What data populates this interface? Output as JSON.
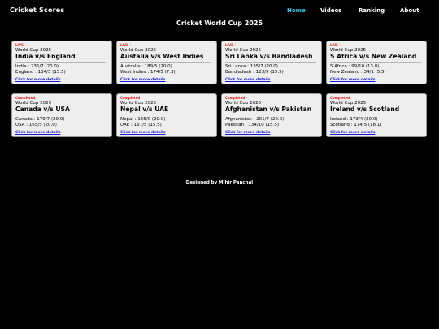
{
  "brand": "Cricket Scores",
  "nav": [
    {
      "label": "Home",
      "active": true
    },
    {
      "label": "Videos",
      "active": false
    },
    {
      "label": "Ranking",
      "active": false
    },
    {
      "label": "About",
      "active": false
    }
  ],
  "page_title": "Cricket World Cup 2025",
  "matches": [
    {
      "status": "LIVE •",
      "tournament": "World Cup 2025",
      "title": "India v/s England",
      "score1": "India : 235/7 (20.0)",
      "score2": "England : 134/5 (15.5)",
      "link": "Click for more details"
    },
    {
      "status": "LIVE •",
      "tournament": "World Cup 2025",
      "title": "Austalia v/s West Indies",
      "score1": "Australia : 189/5 (20.0)",
      "score2": "West Indies : 174/5 (7.3)",
      "link": "Click for more details"
    },
    {
      "status": "LIVE •",
      "tournament": "World Cup 2025",
      "title": "Sri Lanka v/s Bandladesh",
      "score1": "Sri Lanka : 135/7 (20.0)",
      "score2": "Bandladesh : 123/9 (15.5)",
      "link": "Click for more details"
    },
    {
      "status": "LIVE •",
      "tournament": "World Cup 2025",
      "title": "S Africa v/s New Zealand",
      "score1": "S Africa : 99/10 (13.0)",
      "score2": "New Zealand : 34/1 (5.5)",
      "link": "Click for more details"
    },
    {
      "status": "Completed",
      "tournament": "World Cup 2025",
      "title": "Canada v/s USA",
      "score1": "Canada : 179/7 (20.0)",
      "score2": "USA : 165/5 (20.0)",
      "link": "Click for more details"
    },
    {
      "status": "Completed",
      "tournament": "World Cup 2025",
      "title": "Nepal v/s UAE",
      "score1": "Nepal : 166/0 (20.0)",
      "score2": "UAE : 167/5 (15.5)",
      "link": "Click for more details"
    },
    {
      "status": "Completed",
      "tournament": "World Cup 2025",
      "title": "Afghanistan v/s Pakistan",
      "score1": "Afghanistan : 201/7 (20.0)",
      "score2": "Pakistan : 134/10 (15.5)",
      "link": "Click for more details"
    },
    {
      "status": "Completed",
      "tournament": "World Cup 2025",
      "title": "Ireland v/s Scotland",
      "score1": "Ireland : 173/4 (20.0)",
      "score2": "Scotland : 174/5 (18.1)",
      "link": "Click for more details"
    }
  ],
  "footer": "Designed by Mihir Panchal",
  "colors": {
    "background": "#000000",
    "nav_active": "#2ec3e6",
    "status": "#e0201b",
    "link": "#1a1ad8",
    "card": "#eeeeee"
  }
}
